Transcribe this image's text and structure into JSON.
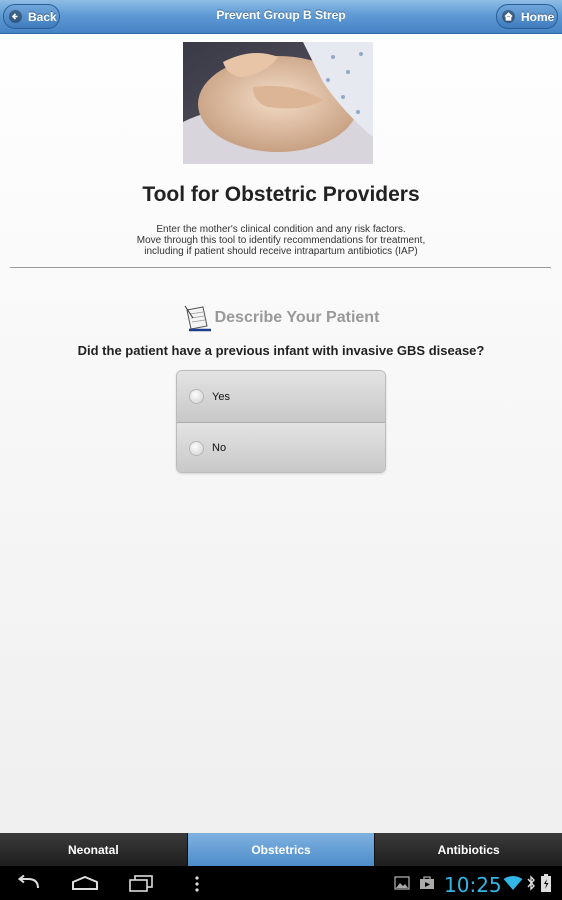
{
  "header": {
    "title": "Prevent Group B Strep",
    "back_label": "Back",
    "home_label": "Home"
  },
  "page": {
    "title": "Tool for Obstetric Providers",
    "intro_lines": [
      "Enter the mother's clinical condition and any risk factors.",
      "Move through this tool to identify recommendations for treatment,",
      "including if patient should receive intrapartum antibiotics (IAP)"
    ]
  },
  "section": {
    "heading": "Describe Your Patient",
    "question": "Did the patient have a previous infant with invasive GBS disease?",
    "options": [
      "Yes",
      "No"
    ]
  },
  "tabs": [
    {
      "label": "Neonatal",
      "active": false
    },
    {
      "label": "Obstetrics",
      "active": true
    },
    {
      "label": "Antibiotics",
      "active": false
    }
  ],
  "system_bar": {
    "time": "10:25"
  },
  "colors": {
    "header_blue": "#4683c6",
    "active_tab": "#5c98d1",
    "clock": "#33b5e5"
  }
}
